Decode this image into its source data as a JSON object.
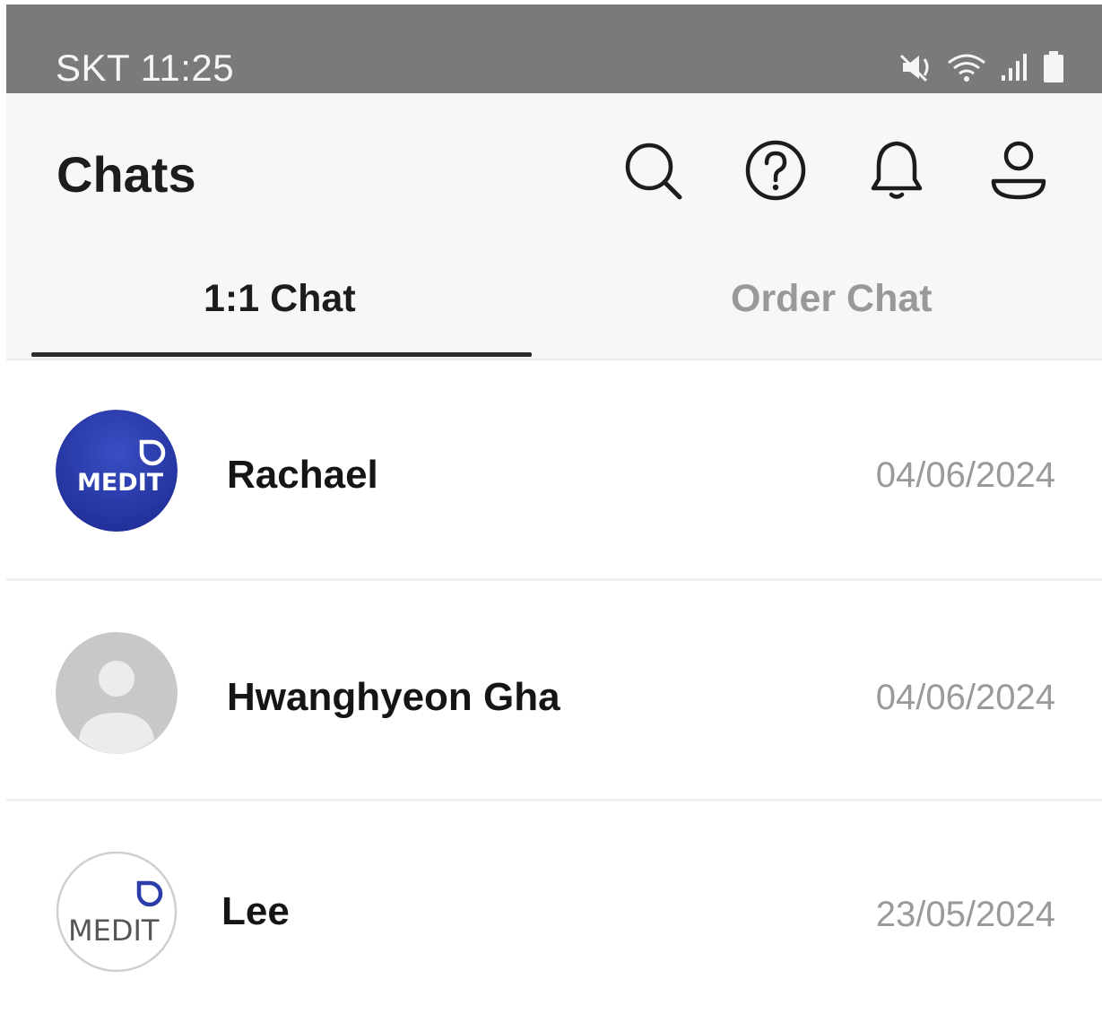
{
  "status_bar": {
    "carrier": "SKT",
    "time": "11:25",
    "icons": [
      "mute-icon",
      "wifi-icon",
      "signal-icon",
      "battery-icon"
    ]
  },
  "header": {
    "title": "Chats",
    "icons": [
      "search-icon",
      "help-icon",
      "bell-icon",
      "profile-icon"
    ]
  },
  "tabs": [
    {
      "label": "1:1 Chat",
      "active": true
    },
    {
      "label": "Order Chat",
      "active": false
    }
  ],
  "chats": [
    {
      "name": "Rachael",
      "date": "04/06/2024",
      "avatar": "medit-logo-blue",
      "avatar_text": "MEDIT"
    },
    {
      "name": "Hwanghyeon Gha",
      "date": "04/06/2024",
      "avatar": "default-person"
    },
    {
      "name": "Lee",
      "date": "23/05/2024",
      "avatar": "medit-logo-white",
      "avatar_text": "MEDIT"
    }
  ],
  "colors": {
    "status_bar": "#7a7a7a",
    "header_bg": "#f7f7f7",
    "medit_blue": "#2a3ca8",
    "inactive_tab": "#999999",
    "date": "#9a9a9a"
  }
}
